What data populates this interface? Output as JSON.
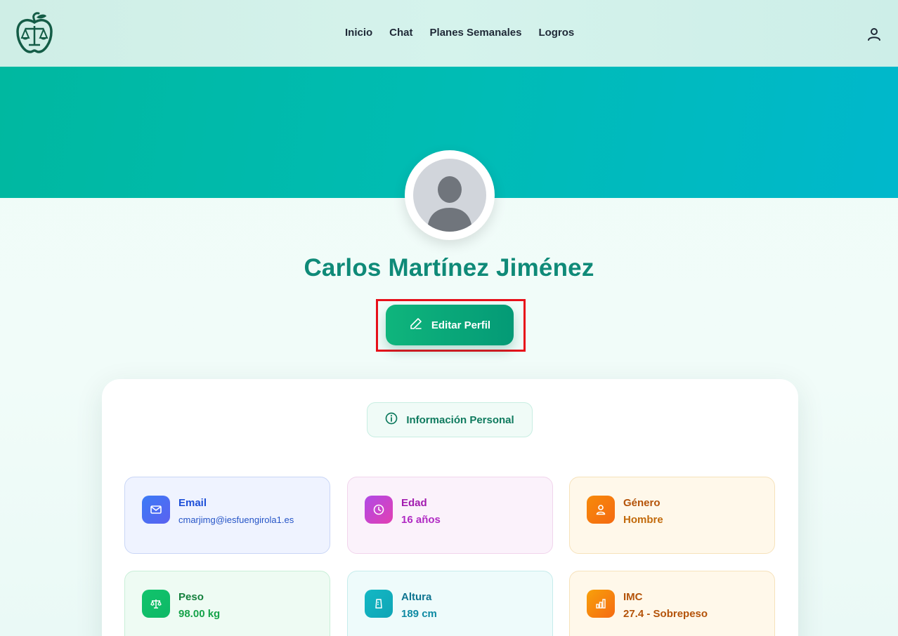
{
  "nav": {
    "items": [
      "Inicio",
      "Chat",
      "Planes Semanales",
      "Logros"
    ]
  },
  "icons": {
    "logo": "apple-scale-logo-icon",
    "user": "user-icon",
    "edit": "pencil-icon",
    "info": "info-icon",
    "email": "mail-icon",
    "age": "clock-icon",
    "gender": "person-icon",
    "weight": "scale-icon",
    "height": "ruler-icon",
    "bmi": "bar-chart-icon"
  },
  "profile": {
    "name": "Carlos Martínez Jiménez",
    "edit_label": "Editar Perfil"
  },
  "section": {
    "title": "Información Personal"
  },
  "fields": {
    "email": {
      "label": "Email",
      "value": "cmarjimg@iesfuengirola1.es"
    },
    "age": {
      "label": "Edad",
      "value": "16 años"
    },
    "gender": {
      "label": "Género",
      "value": "Hombre"
    },
    "weight": {
      "label": "Peso",
      "value": "98.00 kg"
    },
    "height": {
      "label": "Altura",
      "value": "189 cm"
    },
    "bmi": {
      "label": "IMC",
      "value": "27.4 - Sobrepeso"
    }
  },
  "colors": {
    "brand": "#0f8a78",
    "button": "#0fb57c",
    "highlight": "#e8101a"
  }
}
